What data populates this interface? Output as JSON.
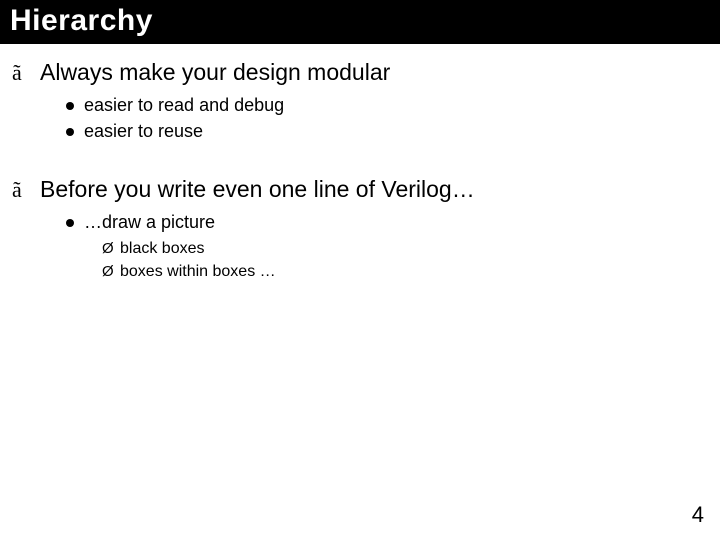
{
  "title": "Hierarchy",
  "bullets": [
    {
      "text": "Always make your design modular",
      "sub": [
        {
          "text": "easier to read and debug"
        },
        {
          "text": "easier to reuse"
        }
      ]
    },
    {
      "text": "Before you write even one line of Verilog…",
      "sub": [
        {
          "text": "…draw a picture",
          "sub": [
            {
              "text": "black boxes"
            },
            {
              "text": "boxes within boxes …"
            }
          ]
        }
      ]
    }
  ],
  "glyphs": {
    "lvl1": "ã",
    "lvl3": "Ø"
  },
  "page_number": "4"
}
